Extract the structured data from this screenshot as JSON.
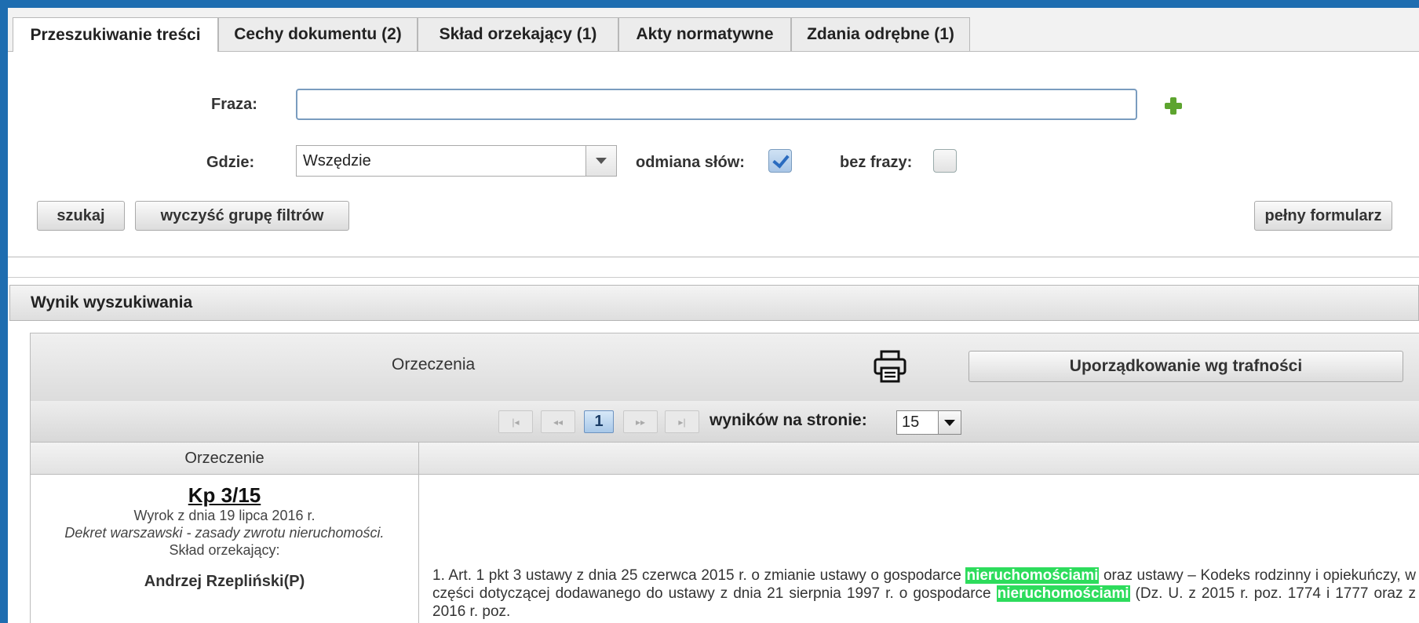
{
  "tabs": [
    {
      "label": "Przeszukiwanie treści",
      "active": true
    },
    {
      "label": "Cechy dokumentu (2)",
      "active": false
    },
    {
      "label": "Skład orzekający (1)",
      "active": false
    },
    {
      "label": "Akty normatywne",
      "active": false
    },
    {
      "label": "Zdania odrębne (1)",
      "active": false
    }
  ],
  "form": {
    "phrase_label": "Fraza:",
    "phrase_value": "",
    "where_label": "Gdzie:",
    "where_value": "Wszędzie",
    "inflection_label": "odmiana słów:",
    "inflection_checked": true,
    "no_phrase_label": "bez frazy:",
    "no_phrase_checked": false,
    "search_button": "szukaj",
    "clear_button": "wyczyść grupę filtrów",
    "full_form_button": "pełny formularz"
  },
  "results": {
    "header": "Wynik wyszukiwania",
    "panel_title": "Orzeczenia",
    "sort_button": "Uporządkowanie wg trafności",
    "pager": {
      "current_page": "1",
      "per_page_label": "wyników na stronie:",
      "per_page_value": "15"
    },
    "columns": [
      "Orzeczenie",
      ""
    ],
    "rows": [
      {
        "signature": "Kp 3/15",
        "date": "Wyrok z dnia 19 lipca 2016 r.",
        "subject": "Dekret warszawski - zasady zwrotu nieruchomości.",
        "panel_label": "Skład orzekający:",
        "judge": "Andrzej Rzepliński(P)",
        "text_before": "1. Art. 1 pkt 3 ustawy z dnia 25 czerwca 2015 r. o zmianie ustawy o gospodarce ",
        "highlight_1": "nieruchomościami",
        "text_middle": " oraz ustawy – Kodeks rodzinny i opiekuńczy, w części dotyczącej dodawanego do ustawy z dnia 21 sierpnia 1997 r. o gospodarce ",
        "highlight_2": "nieruchomościami",
        "text_after": " (Dz. U. z 2015 r. poz. 1774 i 1777 oraz z 2016 r. poz."
      }
    ]
  },
  "colors": {
    "accent_blue": "#1e6db0",
    "highlight_green": "#2ddc5c",
    "plus_green": "#5da42f"
  }
}
